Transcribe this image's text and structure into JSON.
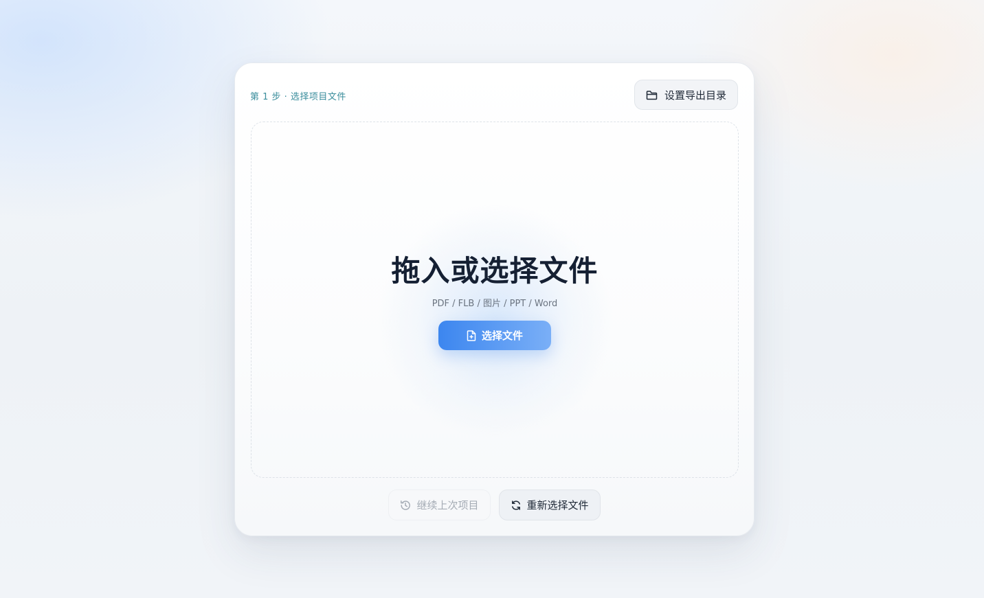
{
  "header": {
    "step_label": "第 1 步 · 选择项目文件",
    "set_export_dir_label": "设置导出目录"
  },
  "dropzone": {
    "title": "拖入或选择文件",
    "formats": "PDF / FLB / 图片 / PPT / Word",
    "choose_label": "选择文件"
  },
  "actions": {
    "continue_label": "继续上次项目",
    "reselect_label": "重新选择文件"
  },
  "icons": {
    "set_export_dir": "folder-icon",
    "choose_file": "file-plus-icon",
    "continue": "history-icon",
    "reselect": "refresh-icon"
  },
  "colors": {
    "accent": "#3c86ef",
    "step_label": "#3a8d9c",
    "title": "#152033"
  }
}
